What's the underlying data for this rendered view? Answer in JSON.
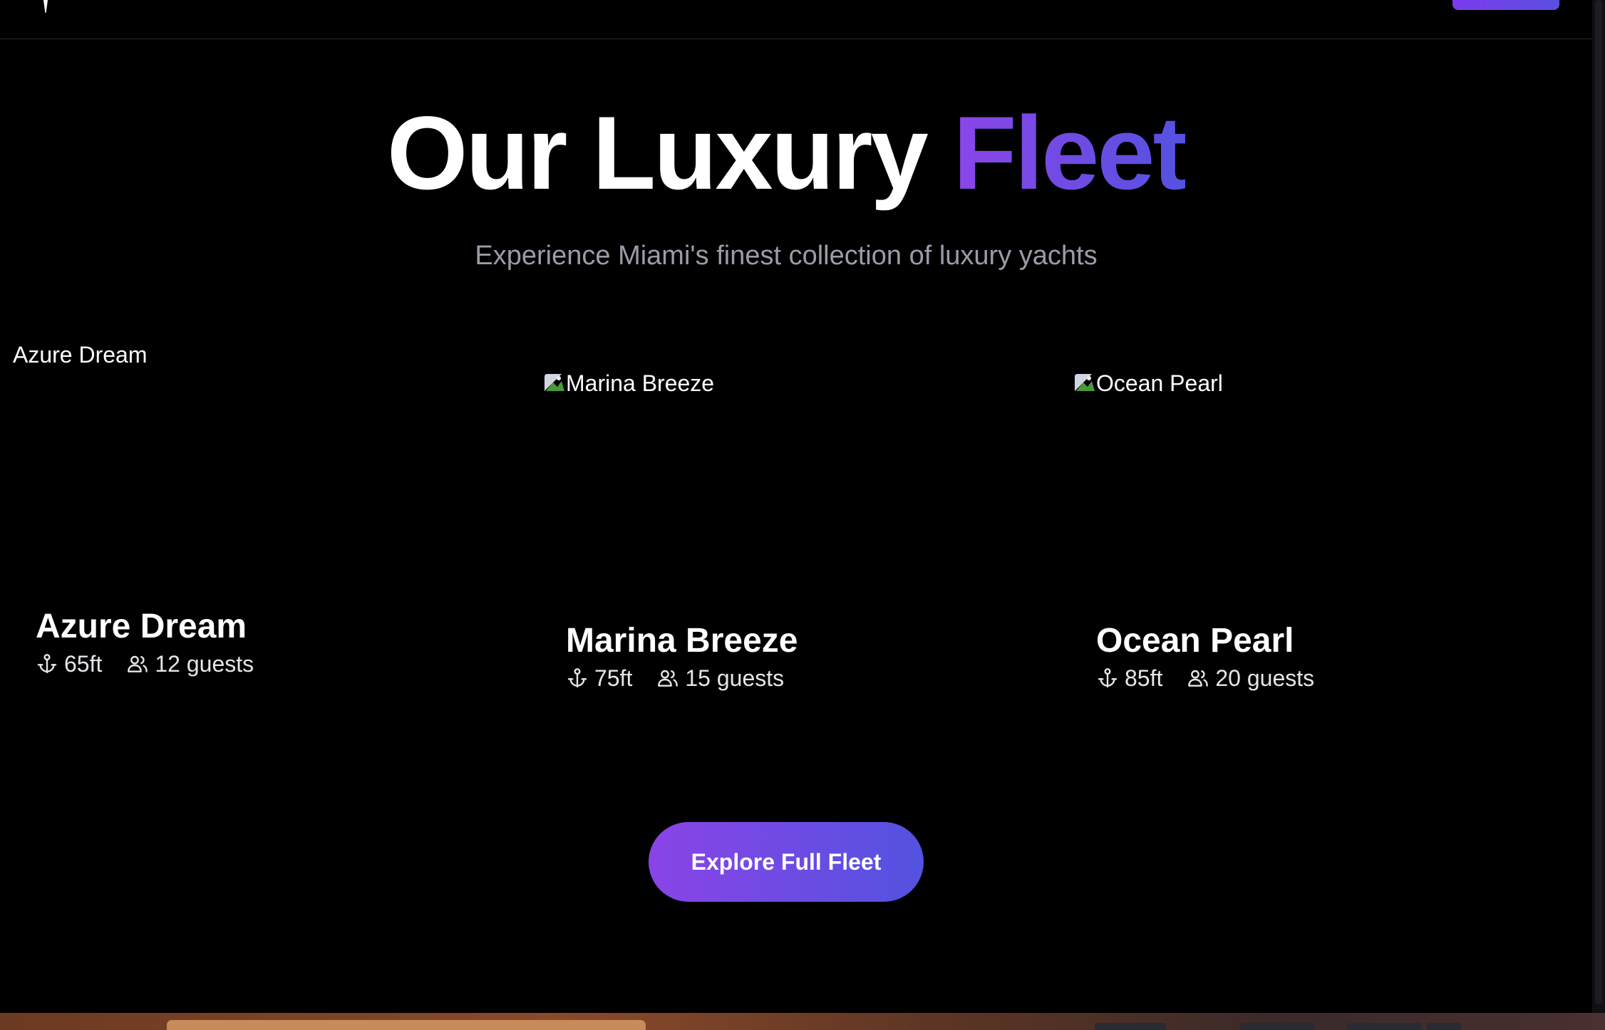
{
  "hero": {
    "title_main": "Our Luxury ",
    "title_accent": "Fleet",
    "subtitle": "Experience Miami's finest collection of luxury yachts"
  },
  "fleet": {
    "cards": [
      {
        "image_alt": "Azure Dream",
        "name": "Azure Dream",
        "length": "65ft",
        "guests": "12 guests"
      },
      {
        "image_alt": "Marina Breeze",
        "name": "Marina Breeze",
        "length": "75ft",
        "guests": "15 guests"
      },
      {
        "image_alt": "Ocean Pearl",
        "name": "Ocean Pearl",
        "length": "85ft",
        "guests": "20 guests"
      }
    ]
  },
  "cta": {
    "explore_label": "Explore Full Fleet"
  },
  "theme": {
    "background": "#000000",
    "accent_start": "#8b45e8",
    "accent_end": "#5452e0",
    "subtitle_color": "#9a9ca8"
  },
  "icons": {
    "length": "anchor-icon",
    "guests": "users-icon",
    "image": "broken-image-icon",
    "logo": "logo-icon"
  }
}
